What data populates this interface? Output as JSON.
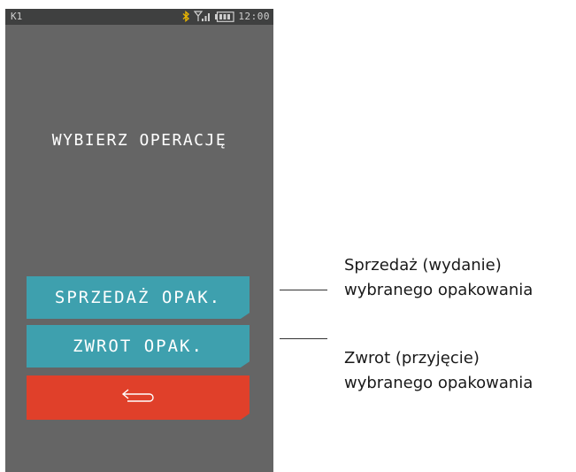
{
  "status_bar": {
    "left_label": "K1",
    "time": "12:00",
    "icons": [
      "bluetooth-icon",
      "signal-icon",
      "battery-icon"
    ]
  },
  "screen": {
    "title": "WYBIERZ OPERACJĘ"
  },
  "buttons": {
    "sale_label": "SPRZEDAŻ OPAK.",
    "return_label": "ZWROT OPAK.",
    "back_icon": "return-arrow-icon"
  },
  "callouts": [
    {
      "line1": "Sprzedaż (wydanie)",
      "line2": "wybranego opakowania"
    },
    {
      "line1": "Zwrot (przyjęcie)",
      "line2": "wybranego opakowania"
    }
  ],
  "colors": {
    "screen_bg": "#656565",
    "status_bg": "#3f4040",
    "button_teal": "#3ea0ae",
    "button_red": "#e0402a",
    "bluetooth": "#e8b400"
  }
}
